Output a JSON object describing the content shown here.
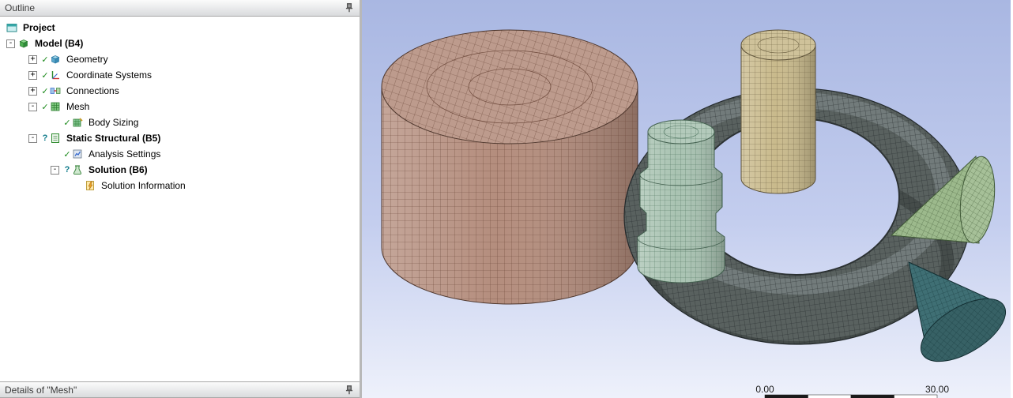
{
  "outline": {
    "title": "Outline",
    "tree": [
      {
        "label": "Project"
      },
      {
        "label": "Model (B4)",
        "expander": "-"
      },
      {
        "label": "Geometry",
        "expander": "+",
        "status": "✓"
      },
      {
        "label": "Coordinate Systems",
        "expander": "+",
        "status": "✓"
      },
      {
        "label": "Connections",
        "expander": "+",
        "status": "✓"
      },
      {
        "label": "Mesh",
        "expander": "-",
        "status": "✓"
      },
      {
        "label": "Body Sizing",
        "status": "✓"
      },
      {
        "label": "Static Structural (B5)",
        "expander": "-",
        "status": "?"
      },
      {
        "label": "Analysis Settings",
        "status": "✓"
      },
      {
        "label": "Solution (B6)",
        "expander": "-",
        "status": "?"
      },
      {
        "label": "Solution Information"
      }
    ]
  },
  "details": {
    "title": "Details of \"Mesh\""
  },
  "viewport": {
    "bg_top": "#a9b7e2",
    "bg_mid": "#c3cdee",
    "bg_bottom": "#eef1fb",
    "ruler": {
      "start": "0.00",
      "end": "30.00"
    },
    "bodies": [
      {
        "name": "large-meshed-cylinder",
        "color": "#b48d7d"
      },
      {
        "name": "meshed-ring",
        "color": "#59615f"
      },
      {
        "name": "small-meshed-cylinder",
        "color": "#c9ba8c"
      },
      {
        "name": "meshed-stepped-shaft",
        "color": "#a9c3b2"
      },
      {
        "name": "meshed-cone-right",
        "color": "#9cb98c"
      },
      {
        "name": "meshed-cone-bottom",
        "color": "#3f6f74"
      }
    ]
  }
}
